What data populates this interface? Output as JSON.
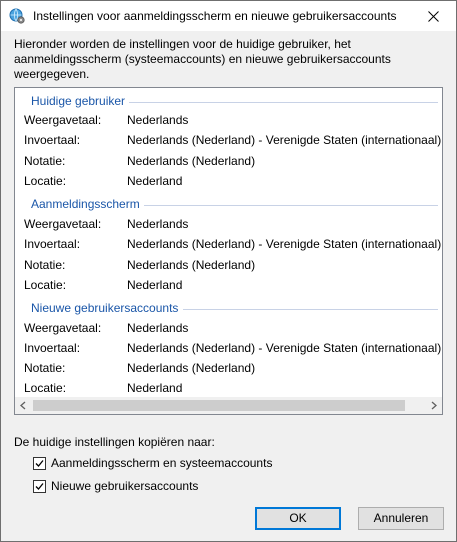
{
  "window": {
    "title": "Instellingen voor aanmeldingsscherm en nieuwe gebruikersaccounts",
    "icon": "globe-settings-icon"
  },
  "intro": "Hieronder worden de instellingen voor de huidige gebruiker, het aanmeldingsscherm (systeemaccounts) en nieuwe gebruikersaccounts weergegeven.",
  "sections": [
    {
      "title": "Huidige gebruiker",
      "rows": [
        {
          "label": "Weergavetaal:",
          "value": "Nederlands"
        },
        {
          "label": "Invoertaal:",
          "value": "Nederlands (Nederland) - Verenigde Staten (internationaal)"
        },
        {
          "label": "Notatie:",
          "value": "Nederlands (Nederland)"
        },
        {
          "label": "Locatie:",
          "value": "Nederland"
        }
      ]
    },
    {
      "title": "Aanmeldingsscherm",
      "rows": [
        {
          "label": "Weergavetaal:",
          "value": "Nederlands"
        },
        {
          "label": "Invoertaal:",
          "value": "Nederlands (Nederland) - Verenigde Staten (internationaal)"
        },
        {
          "label": "Notatie:",
          "value": "Nederlands (Nederland)"
        },
        {
          "label": "Locatie:",
          "value": "Nederland"
        }
      ]
    },
    {
      "title": "Nieuwe gebruikersaccounts",
      "rows": [
        {
          "label": "Weergavetaal:",
          "value": "Nederlands"
        },
        {
          "label": "Invoertaal:",
          "value": "Nederlands (Nederland) - Verenigde Staten (internationaal)"
        },
        {
          "label": "Notatie:",
          "value": "Nederlands (Nederland)"
        },
        {
          "label": "Locatie:",
          "value": "Nederland"
        }
      ]
    }
  ],
  "copy": {
    "label": "De huidige instellingen kopiëren naar:",
    "options": [
      {
        "label": "Aanmeldingsscherm en systeemaccounts",
        "checked": true
      },
      {
        "label": "Nieuwe gebruikersaccounts",
        "checked": true
      }
    ]
  },
  "buttons": {
    "ok": "OK",
    "cancel": "Annuleren"
  },
  "colors": {
    "section_title": "#1a56a8",
    "default_button_border": "#0078d7"
  }
}
